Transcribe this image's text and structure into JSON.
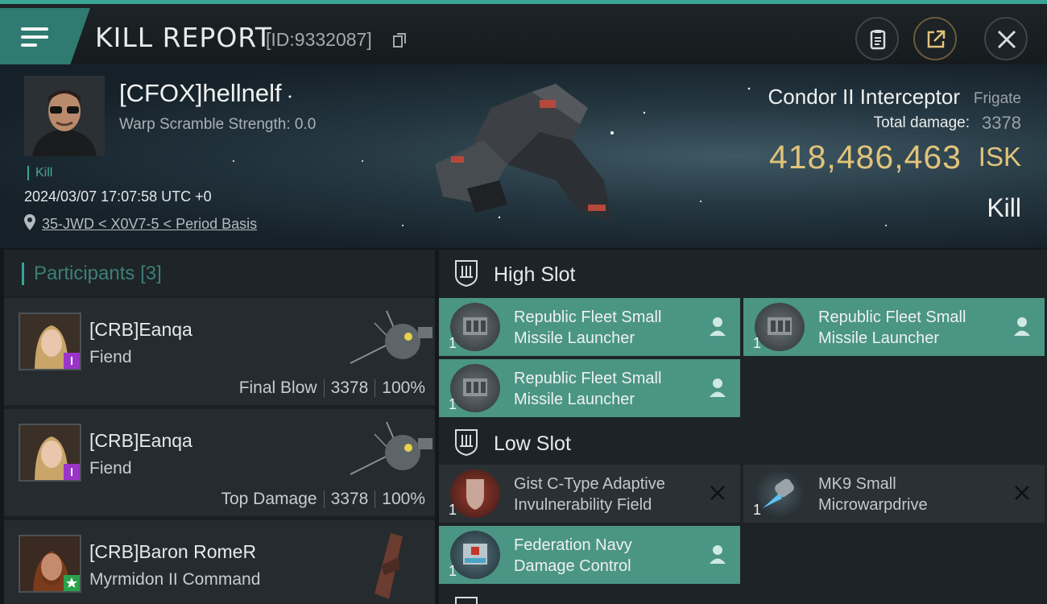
{
  "header": {
    "title": "KILL REPORT",
    "report_id": "[ID:9332087]"
  },
  "victim": {
    "name": "[CFOX]hellnelf",
    "warp_scramble": "Warp Scramble Strength: 0.0",
    "tag": "Kill",
    "datetime": "2024/03/07 17:07:58 UTC +0",
    "location": "35-JWD < X0V7-5 < Period Basis",
    "ship_name": "Condor II Interceptor",
    "ship_class": "Frigate",
    "total_damage_label": "Total damage:",
    "total_damage": "3378",
    "isk_value": "418,486,463",
    "isk_unit": "ISK",
    "result": "Kill"
  },
  "participants": {
    "title": "Participants",
    "count": "[3]",
    "rows": [
      {
        "name": "[CRB]Eanqa",
        "ship": "Fiend",
        "role": "Final Blow",
        "damage": "3378",
        "percent": "100%"
      },
      {
        "name": "[CRB]Eanqa",
        "ship": "Fiend",
        "role": "Top Damage",
        "damage": "3378",
        "percent": "100%"
      },
      {
        "name": "[CRB]Baron RomeR",
        "ship": "Myrmidon II Command",
        "role": "",
        "damage": "",
        "percent": ""
      }
    ]
  },
  "fitting": {
    "high_slot_label": "High Slot",
    "low_slot_label": "Low Slot",
    "high_modules": [
      {
        "name_line1": "Republic Fleet Small",
        "name_line2": "Missile Launcher",
        "qty": "1"
      },
      {
        "name_line1": "Republic Fleet Small",
        "name_line2": "Missile Launcher",
        "qty": "1"
      },
      {
        "name_line1": "Republic Fleet Small",
        "name_line2": "Missile Launcher",
        "qty": "1"
      }
    ],
    "low_modules": [
      {
        "name_line1": "Gist C-Type Adaptive",
        "name_line2": "Invulnerability Field",
        "qty": "1"
      },
      {
        "name_line1": "MK9 Small",
        "name_line2": "Microwarpdrive",
        "qty": "1"
      },
      {
        "name_line1": "Federation Navy",
        "name_line2": "Damage Control",
        "qty": "1"
      }
    ]
  },
  "colors": {
    "accent": "#3aa497",
    "isk_gold": "#e2c37a",
    "dropped_module": "#4b9585",
    "destroyed_module": "#2a3033"
  },
  "icons": [
    "menu-icon",
    "copy-icon",
    "clipboard-icon",
    "share-icon",
    "close-icon",
    "location-pin-icon",
    "shield-slot-icon",
    "person-icon",
    "x-icon"
  ]
}
